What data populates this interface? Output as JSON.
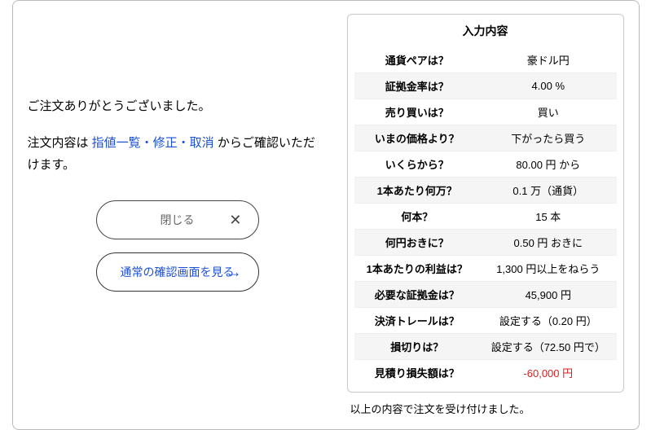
{
  "left": {
    "thanks": "ご注文ありがとうございました。",
    "confirm_prefix": "注文内容は ",
    "confirm_link": "指値一覧・修正・取消",
    "confirm_suffix": " からご確認いただけます。",
    "close_button": "閉じる",
    "normal_view_button": "通常の確認画面を見る"
  },
  "summary": {
    "title": "入力内容",
    "footer": "以上の内容で注文を受け付けました。",
    "rows": [
      {
        "label": "通貨ペアは？",
        "value": "豪ドル円"
      },
      {
        "label": "証拠金率は？",
        "value": "4.00 %"
      },
      {
        "label": "売り買いは？",
        "value": "買い"
      },
      {
        "label": "いまの価格より？",
        "value": "下がったら買う"
      },
      {
        "label": "いくらから？",
        "value": "80.00 円 から"
      },
      {
        "label": "1本あたり何万？",
        "value": "0.1 万（通貨）"
      },
      {
        "label": "何本？",
        "value": "15 本"
      },
      {
        "label": "何円おきに？",
        "value": "0.50 円 おきに"
      },
      {
        "label": "1本あたりの利益は？",
        "value": "1,300 円以上をねらう"
      },
      {
        "label": "必要な証拠金は？",
        "value": "45,900 円"
      },
      {
        "label": "決済トレールは？",
        "value": "設定する（0.20 円）"
      },
      {
        "label": "損切りは？",
        "value": "設定する（72.50 円で）"
      },
      {
        "label": "見積り損失額は？",
        "value": "-60,000 円",
        "negative": true
      }
    ]
  }
}
